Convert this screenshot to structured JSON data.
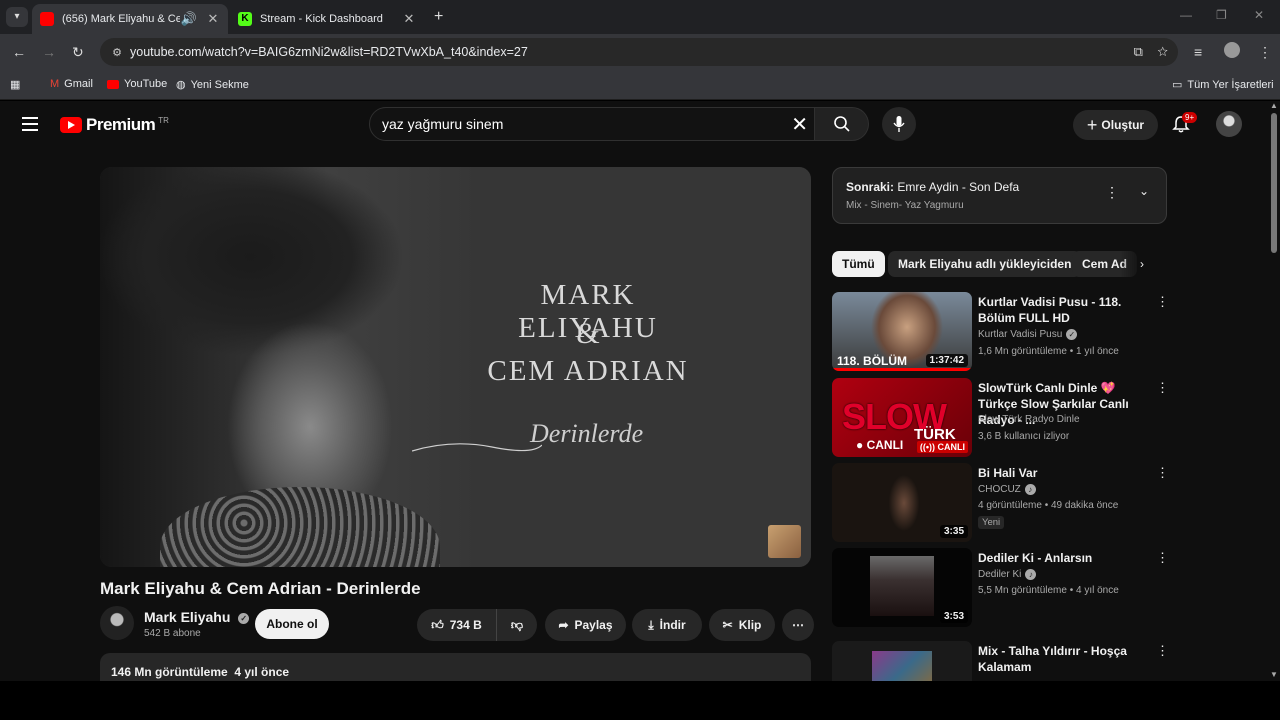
{
  "browser": {
    "tabs": [
      {
        "title": "(656) Mark Eliyahu & Cem A",
        "active": true
      },
      {
        "title": "Stream - Kick Dashboard",
        "active": false
      }
    ],
    "url": "youtube.com/watch?v=BAIG6zmNi2w&list=RD2TVwXbA_t40&index=27",
    "bookmarks": [
      "Gmail",
      "YouTube",
      "Yeni Sekme"
    ],
    "all_bookmarks": "Tüm Yer İşaretleri"
  },
  "masthead": {
    "logo": "Premium",
    "country": "TR",
    "search_value": "yaz yağmuru sinem",
    "create_label": "Oluştur",
    "notifications": "9+"
  },
  "player_art": {
    "line1": "MARK ELIYAHU",
    "amp": "&",
    "line2": "CEM ADRIAN",
    "script": "Derinlerde"
  },
  "video": {
    "title": "Mark Eliyahu & Cem Adrian - Derinlerde",
    "channel": "Mark Eliyahu",
    "subscribers": "542 B abone",
    "subscribe_label": "Abone ol",
    "likes": "734 B",
    "share": "Paylaş",
    "download": "İndir",
    "clip": "Klip",
    "views_date": "146 Mn görüntüleme  4 yıl önce"
  },
  "up_next": {
    "label": "Sonraki:",
    "title": "Emre Aydin - Son Defa",
    "playlist": "Mix - Sinem- Yaz Yagmuru"
  },
  "chips": [
    "Tümü",
    "Mark Eliyahu adlı yükleyiciden",
    "Cem Ad"
  ],
  "recommendations": [
    {
      "title": "Kurtlar Vadisi Pusu - 118. Bölüm FULL HD",
      "channel": "Kurtlar Vadisi Pusu",
      "meta": "1,6 Mn görüntüleme • 1 yıl önce",
      "duration": "1:37:42",
      "overlay": "118. BÖLÜM"
    },
    {
      "title": "SlowTürk Canlı Dinle 💖 Türkçe Slow Şarkılar Canlı Radyo - ...",
      "channel": "Slow Türk Radyo Dinle",
      "meta": "3,6 B kullanıcı izliyor",
      "overlay": "SLOW",
      "overlay2": "TÜRK",
      "live1": "● CANLI",
      "live2": "((•)) CANLI"
    },
    {
      "title": "Bi Hali Var",
      "channel": "CHOCUZ",
      "meta": "4 görüntüleme • 49 dakika önce",
      "duration": "3:35",
      "badge": "Yeni"
    },
    {
      "title": "Dediler Ki - Anlarsın",
      "channel": "Dediler Ki",
      "meta": "5,5 Mn görüntüleme • 4 yıl önce",
      "duration": "3:53"
    },
    {
      "title": "Mix - Talha Yıldırır - Hoşça Kalamam"
    }
  ]
}
